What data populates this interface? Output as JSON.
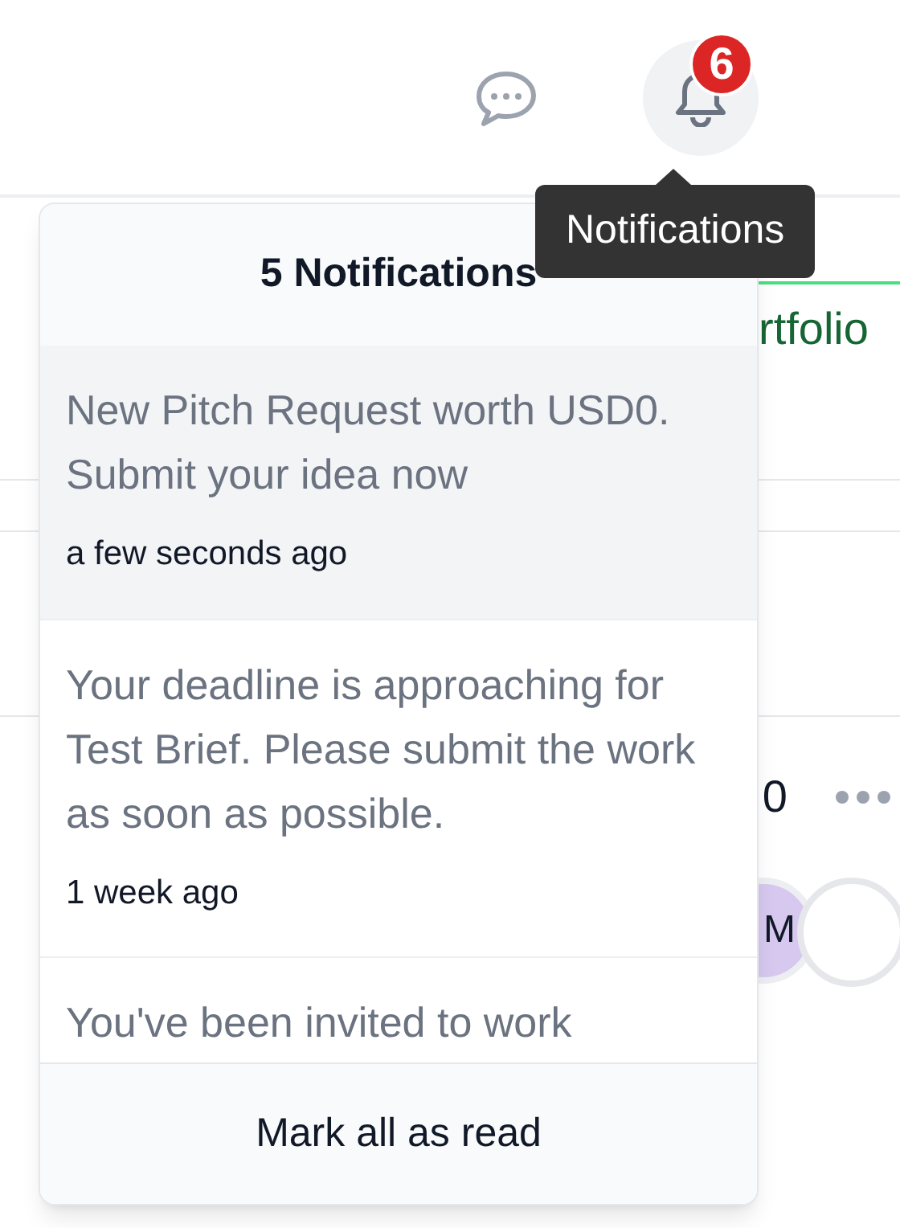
{
  "header": {
    "badge": "6",
    "tooltip": "Notifications"
  },
  "background": {
    "tab_label": "rtfolio",
    "value": "0",
    "avatar": "M"
  },
  "popup": {
    "title": "5 Notifications",
    "notifications": [
      {
        "text": "New Pitch Request worth USD0. Submit your idea now",
        "time": "a few seconds ago",
        "unread": true
      },
      {
        "text": "Your deadline is approaching for Test Brief. Please submit the work as soon as possible.",
        "time": "1 week ago",
        "unread": false
      },
      {
        "text": "You've been invited to work",
        "unread": false
      }
    ],
    "footer": "Mark all as read"
  }
}
